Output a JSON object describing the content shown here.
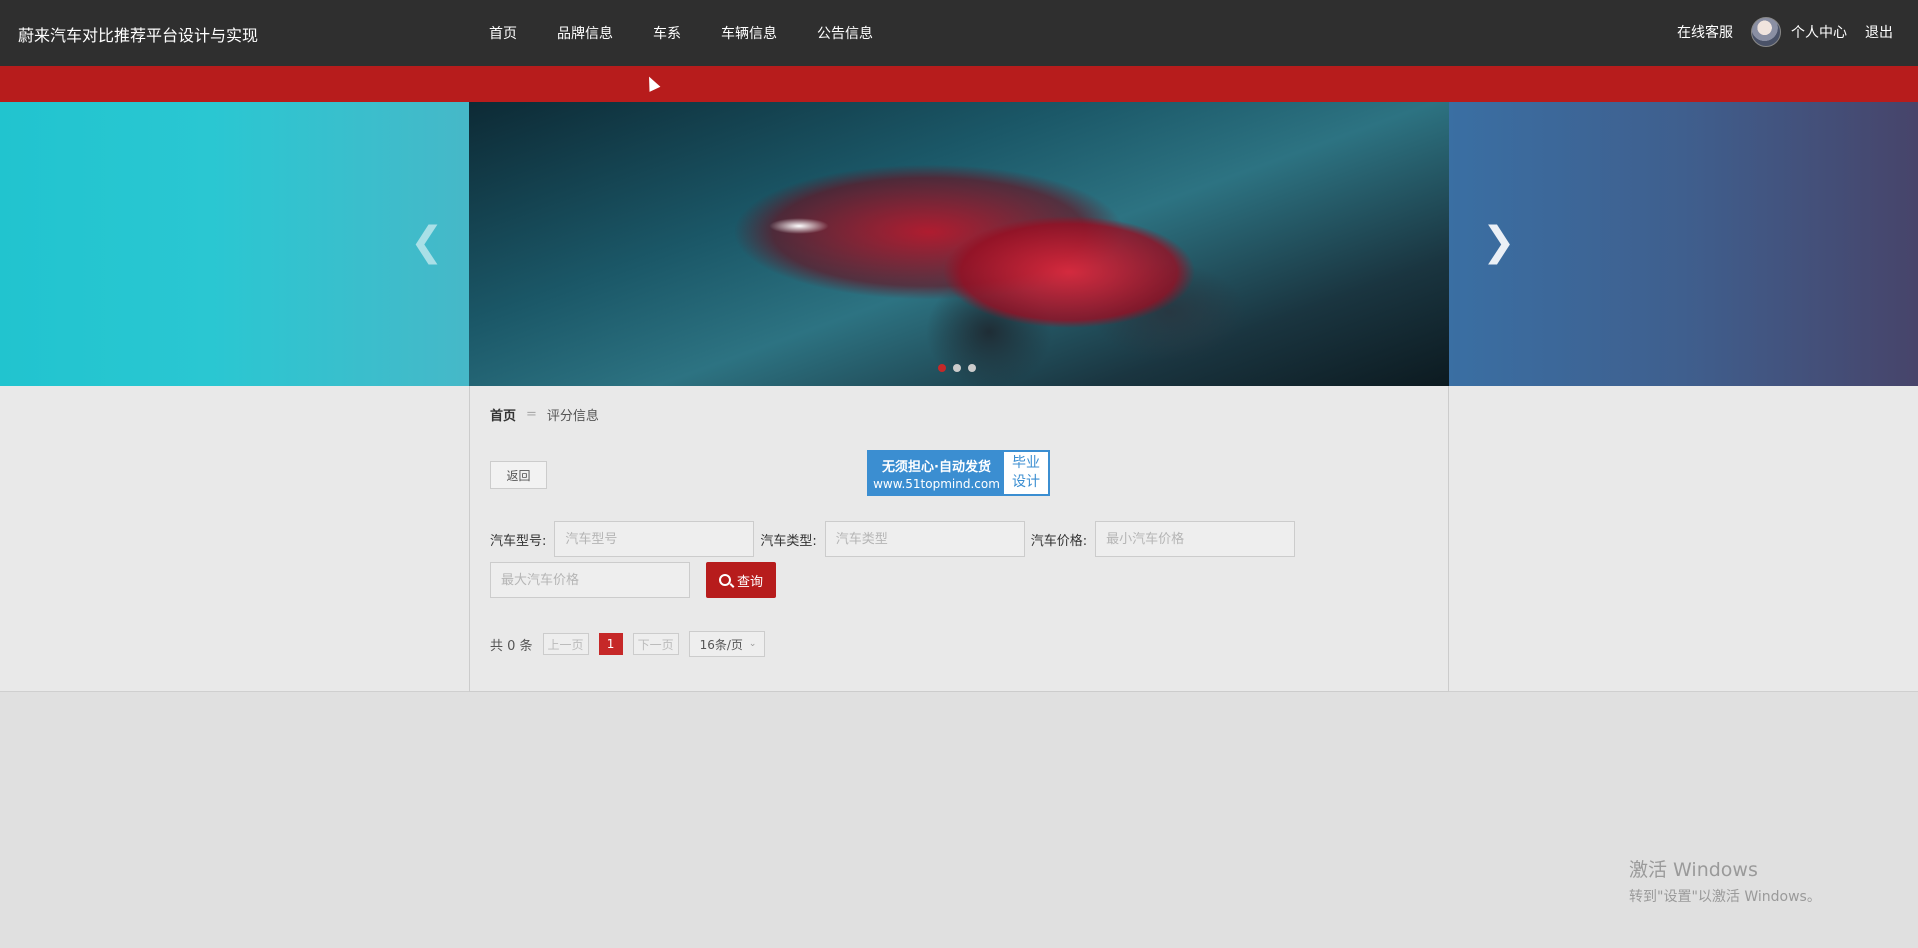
{
  "header": {
    "brand": "蔚来汽车对比推荐平台设计与实现",
    "nav": [
      "首页",
      "品牌信息",
      "车系",
      "车辆信息",
      "公告信息"
    ],
    "right": {
      "service": "在线客服",
      "profile": "个人中心",
      "logout": "退出"
    }
  },
  "carousel": {
    "prev_icon": "chevron-left-icon",
    "next_icon": "chevron-right-icon",
    "dots": 3,
    "active_dot": 1
  },
  "breadcrumb": {
    "home": "首页",
    "separator": "=",
    "current": "评分信息"
  },
  "back_label": "返回",
  "promo": {
    "line1": "无须担心·自动发货",
    "line2": "www.51topmind.com",
    "badge_line1": "毕业",
    "badge_line2": "设计"
  },
  "search": {
    "model_label": "汽车型号:",
    "model_placeholder": "汽车型号",
    "type_label": "汽车类型:",
    "type_placeholder": "汽车类型",
    "price_label": "汽车价格:",
    "min_price_placeholder": "最小汽车价格",
    "max_price_placeholder": "最大汽车价格",
    "query_label": "查询"
  },
  "pager": {
    "total": "共 0 条",
    "prev": "上一页",
    "page": "1",
    "next": "下一页",
    "size": "16条/页"
  },
  "watermark": {
    "line1": "激活 Windows",
    "line2": "转到\"设置\"以激活 Windows。"
  },
  "colors": {
    "topbar": "#2f2f2f",
    "accent": "#b71c1c",
    "promo": "#3b8ed1"
  }
}
